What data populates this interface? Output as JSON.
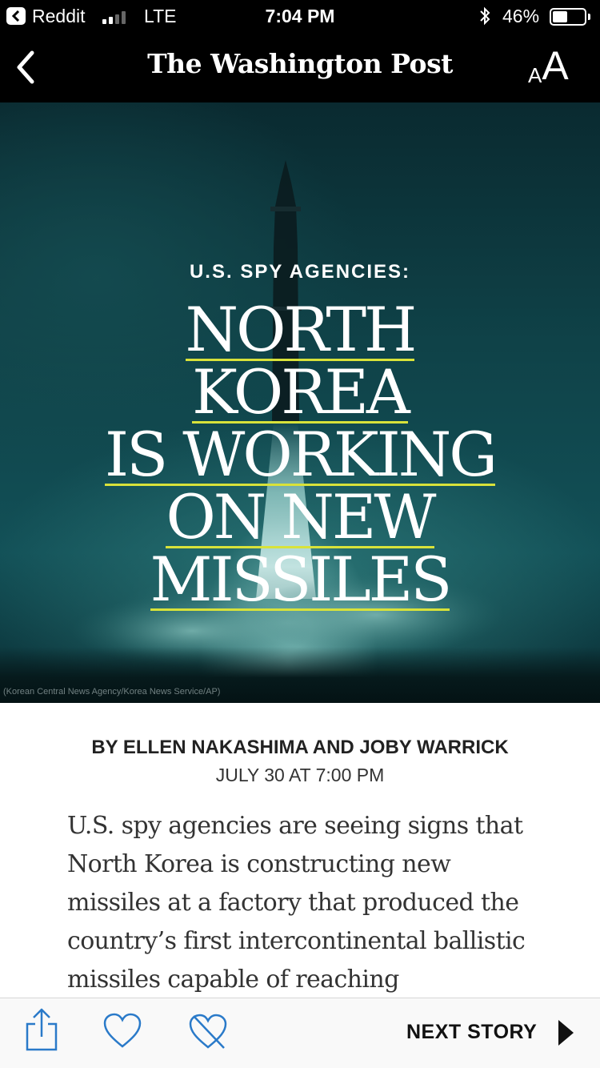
{
  "status_bar": {
    "back_app": "Reddit",
    "network": "LTE",
    "time": "7:04 PM",
    "battery": "46%",
    "battery_level": 0.46,
    "signal_bars": 2,
    "signal_bars_total": 4
  },
  "nav": {
    "logo": "The Washington Post",
    "text_size_small": "A",
    "text_size_large": "A"
  },
  "hero": {
    "kicker": "U.S. SPY AGENCIES:",
    "headline_lines": [
      "NORTH",
      "KOREA",
      "IS WORKING",
      "ON NEW",
      "MISSILES"
    ],
    "photo_credit": "(Korean Central News Agency/Korea News Service/AP)",
    "underline_color": "#d8e23a"
  },
  "article": {
    "byline": "BY ELLEN NAKASHIMA AND JOBY WARRICK",
    "date": "JULY 30 AT 7:00 PM",
    "body": "U.S. spy agencies are seeing signs that North Korea is constructing new missiles at a factory that produced the country’s first intercontinental ballistic missiles capable of reaching"
  },
  "toolbar": {
    "next_label": "NEXT STORY",
    "accent": "#2a7ac9"
  }
}
